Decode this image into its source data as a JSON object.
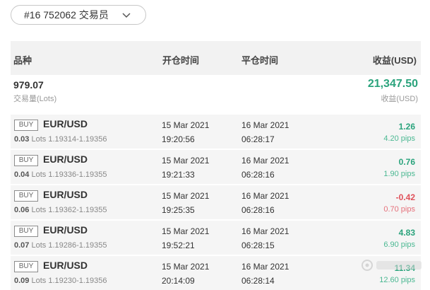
{
  "trader_selector": {
    "label": "#16 752062 交易员"
  },
  "table_header": {
    "instrument": "品种",
    "open_time": "开仓时间",
    "close_time": "平仓时间",
    "profit": "收益(USD)"
  },
  "summary": {
    "volume": "979.07",
    "volume_label": "交易量(Lots)",
    "profit": "21,347.50",
    "profit_label": "收益(USD)"
  },
  "trades": [
    {
      "side": "BUY",
      "symbol": "EUR/USD",
      "lots": "0.03",
      "lots_unit": "Lots",
      "price_range": "1.19314-1.19356",
      "open_date": "15 Mar 2021",
      "open_time": "19:20:56",
      "close_date": "16 Mar 2021",
      "close_time": "06:28:17",
      "profit": "1.26",
      "pips": "4.20 pips",
      "direction": "positive"
    },
    {
      "side": "BUY",
      "symbol": "EUR/USD",
      "lots": "0.04",
      "lots_unit": "Lots",
      "price_range": "1.19336-1.19355",
      "open_date": "15 Mar 2021",
      "open_time": "19:21:33",
      "close_date": "16 Mar 2021",
      "close_time": "06:28:16",
      "profit": "0.76",
      "pips": "1.90 pips",
      "direction": "positive"
    },
    {
      "side": "BUY",
      "symbol": "EUR/USD",
      "lots": "0.06",
      "lots_unit": "Lots",
      "price_range": "1.19362-1.19355",
      "open_date": "15 Mar 2021",
      "open_time": "19:25:35",
      "close_date": "16 Mar 2021",
      "close_time": "06:28:16",
      "profit": "-0.42",
      "pips": "0.70 pips",
      "direction": "negative"
    },
    {
      "side": "BUY",
      "symbol": "EUR/USD",
      "lots": "0.07",
      "lots_unit": "Lots",
      "price_range": "1.19286-1.19355",
      "open_date": "15 Mar 2021",
      "open_time": "19:52:21",
      "close_date": "16 Mar 2021",
      "close_time": "06:28:15",
      "profit": "4.83",
      "pips": "6.90 pips",
      "direction": "positive"
    },
    {
      "side": "BUY",
      "symbol": "EUR/USD",
      "lots": "0.09",
      "lots_unit": "Lots",
      "price_range": "1.19230-1.19356",
      "open_date": "15 Mar 2021",
      "open_time": "20:14:09",
      "close_date": "16 Mar 2021",
      "close_time": "06:28:14",
      "profit": "11.34",
      "pips": "12.60 pips",
      "direction": "positive"
    }
  ],
  "colors": {
    "positive": "#2aa37c",
    "negative": "#e0505a",
    "header_bg": "#f2f2f2",
    "row_bg": "#f5f5f5"
  },
  "icons": {
    "selector_chevron": "chevron-down-icon",
    "watermark": "watermark-logo-icon"
  }
}
